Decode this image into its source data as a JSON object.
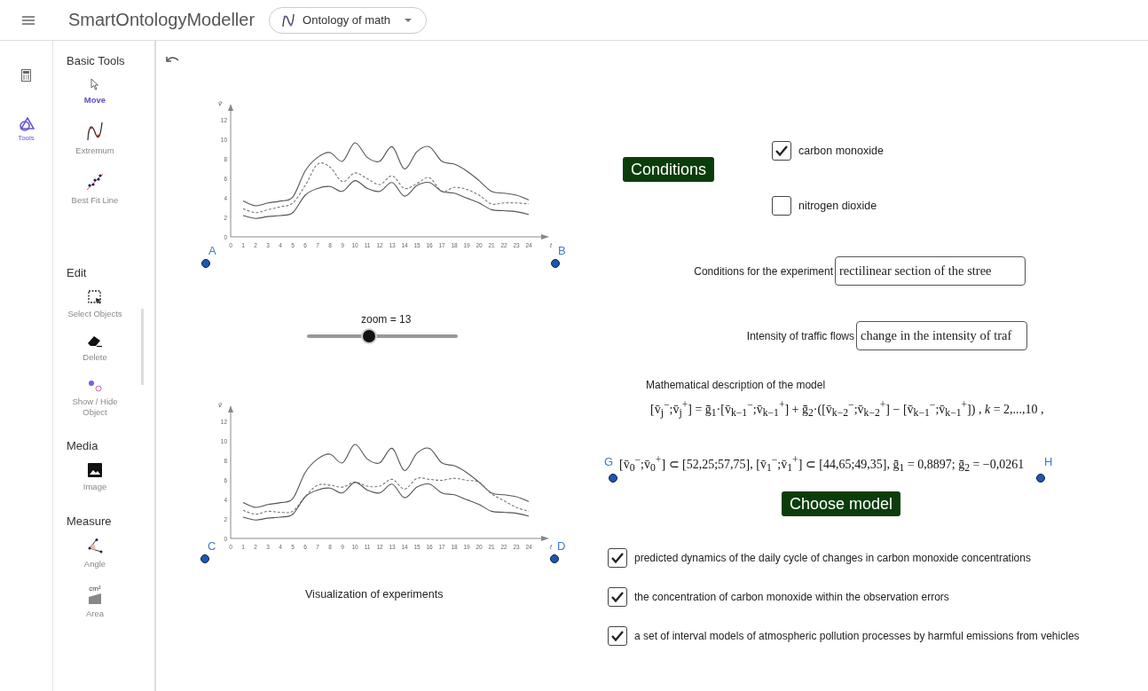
{
  "header": {
    "app_title": "SmartOntologyModeller",
    "dropdown": "Ontology of math"
  },
  "rail": [
    {
      "kind": "calculator",
      "selected": false
    },
    {
      "kind": "tools",
      "label": "Tools",
      "selected": true
    }
  ],
  "tool_sections": [
    {
      "title": "Basic Tools",
      "items": [
        {
          "kind": "pointer",
          "label": "Move",
          "selected": true
        },
        {
          "kind": "extremum",
          "label": "Extremum",
          "selected": false
        },
        {
          "kind": "bestfit",
          "label": "Best Fit Line",
          "selected": false
        }
      ]
    },
    {
      "title": "Edit",
      "items": [
        {
          "kind": "select",
          "label": "Select Objects",
          "selected": false
        },
        {
          "kind": "eraser",
          "label": "Delete",
          "selected": false
        },
        {
          "kind": "showhide",
          "label": "Show / Hide Object",
          "selected": false
        }
      ]
    },
    {
      "title": "Media",
      "items": [
        {
          "kind": "image",
          "label": "Image",
          "selected": false
        }
      ]
    },
    {
      "title": "Measure",
      "items": [
        {
          "kind": "angle",
          "label": "Angle",
          "selected": false
        },
        {
          "kind": "area",
          "label": "Area",
          "selected": false,
          "badge": "cm²"
        }
      ]
    }
  ],
  "charts": [
    {
      "points": [
        "A",
        "B"
      ],
      "chart_data": {
        "type": "line",
        "xlabel": "t",
        "ylabel": "v̄",
        "x": [
          1,
          2,
          3,
          4,
          5,
          6,
          7,
          8,
          9,
          10,
          11,
          12,
          13,
          14,
          15,
          16,
          17,
          18,
          19,
          20,
          21,
          22,
          23,
          24
        ],
        "xticks": [
          0,
          1,
          2,
          3,
          4,
          5,
          6,
          7,
          8,
          9,
          10,
          11,
          12,
          13,
          14,
          15,
          16,
          17,
          18,
          19,
          20,
          21,
          22,
          23,
          24
        ],
        "yticks": [
          0,
          2,
          4,
          6,
          8,
          10,
          12
        ],
        "xlim": [
          0,
          25
        ],
        "ylim": [
          0,
          13
        ],
        "series": [
          {
            "color": "#555555",
            "line_style": "solid",
            "values": [
              3.7,
              3.2,
              3.5,
              3.7,
              4.1,
              6.8,
              8.2,
              8.7,
              7.8,
              9.7,
              8.2,
              7.8,
              9.3,
              7.0,
              8.8,
              9.3,
              7.8,
              7.5,
              6.8,
              5.8,
              4.7,
              4.5,
              4.3,
              3.8
            ]
          },
          {
            "color": "#777777",
            "line_style": "dashed",
            "values": [
              2.9,
              2.5,
              2.8,
              3.1,
              3.5,
              5.3,
              7.5,
              7.2,
              5.7,
              6.6,
              6.0,
              5.4,
              6.3,
              5.0,
              5.5,
              6.1,
              4.7,
              5.1,
              4.9,
              4.3,
              3.4,
              3.5,
              3.5,
              3.4
            ]
          },
          {
            "color": "#555555",
            "line_style": "solid",
            "values": [
              2.2,
              1.9,
              2.1,
              2.2,
              2.5,
              4.3,
              5.0,
              5.2,
              4.7,
              5.8,
              5.0,
              4.7,
              5.6,
              4.2,
              5.3,
              5.6,
              4.7,
              4.5,
              4.0,
              3.5,
              2.8,
              2.7,
              2.6,
              2.3
            ]
          }
        ]
      }
    },
    {
      "points": [
        "C",
        "D"
      ],
      "chart_data": {
        "type": "line",
        "xlabel": "t",
        "ylabel": "v̄",
        "x": [
          1,
          2,
          3,
          4,
          5,
          6,
          7,
          8,
          9,
          10,
          11,
          12,
          13,
          14,
          15,
          16,
          17,
          18,
          19,
          20,
          21,
          22,
          23,
          24
        ],
        "xticks": [
          0,
          1,
          2,
          3,
          4,
          5,
          6,
          7,
          8,
          9,
          10,
          11,
          12,
          13,
          14,
          15,
          16,
          17,
          18,
          19,
          20,
          21,
          22,
          23,
          24
        ],
        "yticks": [
          0,
          2,
          4,
          6,
          8,
          10,
          12
        ],
        "xlim": [
          0,
          25
        ],
        "ylim": [
          0,
          13
        ],
        "series": [
          {
            "color": "#555555",
            "line_style": "solid",
            "values": [
              3.7,
              3.2,
              3.5,
              3.7,
              4.1,
              6.8,
              8.2,
              8.7,
              7.8,
              9.7,
              8.2,
              7.8,
              9.3,
              7.0,
              8.8,
              9.3,
              7.8,
              7.5,
              6.8,
              5.8,
              4.7,
              4.5,
              4.3,
              3.8
            ]
          },
          {
            "color": "#777777",
            "line_style": "dashed",
            "values": [
              2.9,
              2.5,
              2.8,
              2.7,
              2.8,
              4.3,
              5.5,
              5.5,
              5.3,
              5.8,
              5.4,
              5.4,
              6.1,
              5.1,
              6.2,
              6.1,
              6.0,
              6.2,
              6.0,
              5.8,
              4.6,
              3.9,
              3.2,
              2.8
            ]
          },
          {
            "color": "#555555",
            "line_style": "solid",
            "values": [
              2.2,
              1.9,
              2.1,
              2.2,
              2.5,
              4.3,
              5.0,
              5.2,
              4.7,
              5.8,
              5.0,
              4.7,
              5.6,
              4.2,
              5.3,
              5.6,
              4.7,
              4.5,
              4.0,
              3.5,
              2.8,
              2.7,
              2.6,
              2.3
            ]
          }
        ]
      }
    }
  ],
  "slider": {
    "label": "zoom = 13",
    "level": 0.41
  },
  "conditions_button": "Conditions",
  "pollutants": [
    {
      "label": "carbon monoxide",
      "checked": true
    },
    {
      "label": "nitrogen dioxide",
      "checked": false
    }
  ],
  "fields": [
    {
      "label": "Conditions for the experiment",
      "value": "rectilinear section of the stree"
    },
    {
      "label": "Intensity of traffic flows",
      "value": "change in the intensity of traf"
    }
  ],
  "description": "Mathematical description of the model",
  "formula": [
    "[v̄$_{j}$$^{−}$;v̄$_{j}$$^{+}$] = ḡ$_{1}$·[v̄$_{k−1}$$^{−}$;v̄$_{k−1}$$^{+}$] + ḡ$_{2}$·([v̄$_{k−2}$$^{−}$;v̄$_{k−2}$$^{+}$] − [v̄$_{k−1}$$^{−}$;v̄$_{k−1}$$^{+}$]) , *k* = 2,...,10 ,",
    "[v̄$_{0}$$^{−}$;v̄$_{0}$$^{+}$] ⊂ [52,25;57,75], [v̄$_{1}$$^{−}$;v̄$_{1}$$^{+}$] ⊂ [44,65;49,35], ḡ$_{1}$ = 0,8897; ḡ$_{2}$ = −0,0261"
  ],
  "formula_points": [
    "G",
    "H"
  ],
  "choose_button": "Choose model",
  "results": [
    {
      "label": "predicted dynamics of the daily cycle of changes in carbon monoxide concentrations",
      "checked": true
    },
    {
      "label": "the concentration of carbon monoxide within the observation errors",
      "checked": true
    },
    {
      "label": "a set of interval models of atmospheric pollution processes by harmful emissions from vehicles",
      "checked": true
    }
  ],
  "caption": "Visualization of experiments"
}
